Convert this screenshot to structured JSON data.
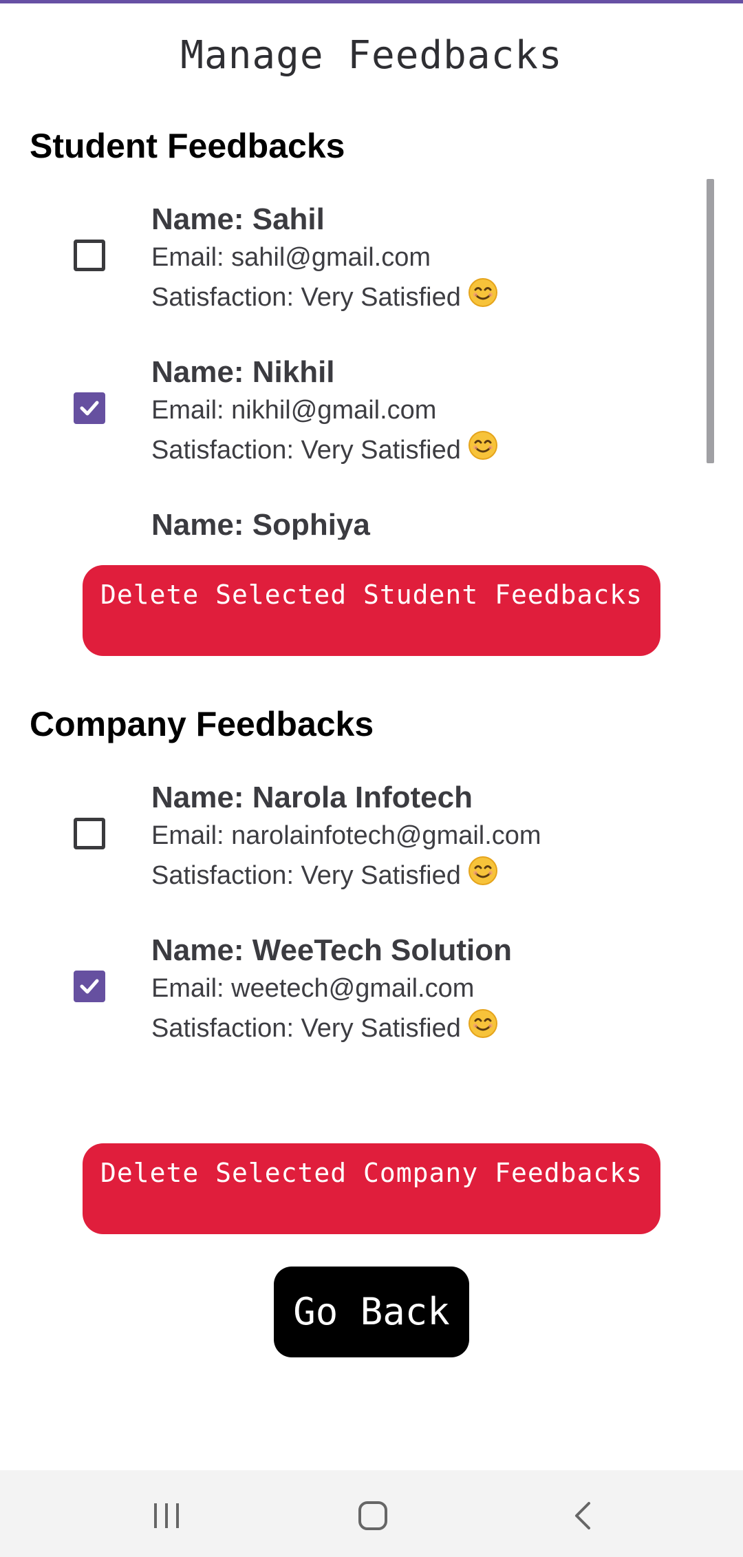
{
  "colors": {
    "accent": "#6650a0",
    "danger": "#e01e3c",
    "topbar": "#6750a4"
  },
  "page_title": "Manage Feedbacks",
  "student_section": {
    "title": "Student Feedbacks",
    "items": [
      {
        "name": "Name: Sahil",
        "email": "Email: sahil@gmail.com",
        "satisfaction": "Satisfaction: Very Satisfied",
        "emoji": "smiling-face-emoji",
        "checked": false
      },
      {
        "name": "Name: Nikhil",
        "email": "Email: nikhil@gmail.com",
        "satisfaction": "Satisfaction: Very Satisfied",
        "emoji": "smiling-face-emoji",
        "checked": true
      },
      {
        "name": "Name: Sophiya"
      }
    ],
    "delete_label": "Delete Selected Student Feedbacks"
  },
  "company_section": {
    "title": "Company Feedbacks",
    "items": [
      {
        "name": "Name: Narola Infotech",
        "email": "Email: narolainfotech@gmail.com",
        "satisfaction": "Satisfaction: Very Satisfied",
        "emoji": "smiling-face-emoji",
        "checked": false
      },
      {
        "name": "Name: WeeTech Solution",
        "email": "Email: weetech@gmail.com",
        "satisfaction": "Satisfaction: Very Satisfied",
        "emoji": "smiling-face-emoji",
        "checked": true
      }
    ],
    "delete_label": "Delete Selected Company Feedbacks"
  },
  "go_back_label": "Go Back",
  "navbar": {
    "icons": [
      "recent-apps-icon",
      "home-icon",
      "back-icon"
    ]
  }
}
